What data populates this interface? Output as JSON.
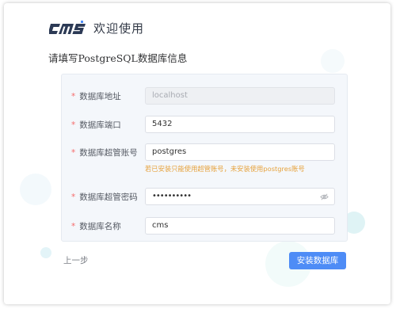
{
  "header": {
    "logo_text": "cms",
    "welcome": "欢迎使用",
    "subtitle": "请填写PostgreSQL数据库信息"
  },
  "form": {
    "required_mark": "*",
    "fields": [
      {
        "label": "数据库地址",
        "value": "localhost",
        "disabled": true
      },
      {
        "label": "数据库端口",
        "value": "5432"
      },
      {
        "label": "数据库超管账号",
        "value": "postgres"
      },
      {
        "label": "数据库超管密码",
        "value": "••••••••••",
        "type": "password"
      },
      {
        "label": "数据库名称",
        "value": "cms"
      }
    ],
    "hint": "若已安装只能使用超管账号，未安装使用postgres账号"
  },
  "footer": {
    "prev_label": "上一步",
    "install_label": "安装数据库"
  },
  "colors": {
    "accent": "#4e8cf6",
    "required": "#f56c6c",
    "hint": "#e6a23c",
    "logo": "#2c3a55"
  },
  "icons": {
    "password_toggle": "eye-icon"
  }
}
